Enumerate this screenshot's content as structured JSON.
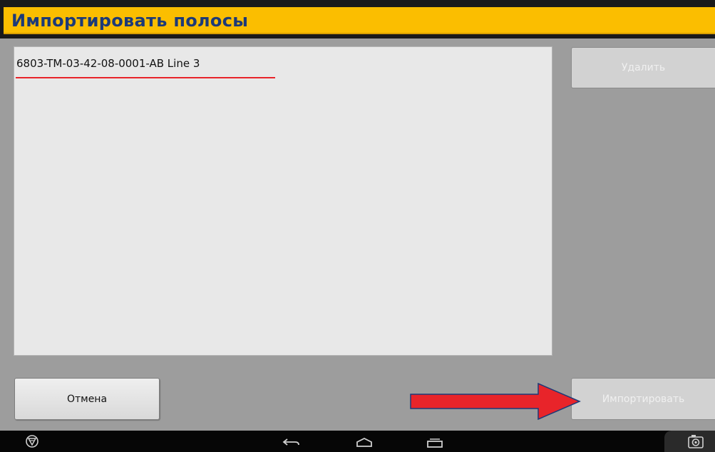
{
  "header": {
    "title": "Импортировать полосы"
  },
  "list": {
    "items": [
      {
        "label": "6803-TM-03-42-08-0001-AB Line 3"
      }
    ]
  },
  "buttons": {
    "delete_label": "Удалить",
    "cancel_label": "Отмена",
    "import_label": "Импортировать"
  },
  "nav": {
    "icons": [
      "app-logo-icon",
      "back-icon",
      "home-icon",
      "recent-apps-icon",
      "screenshot-icon"
    ]
  },
  "colors": {
    "header_background": "#fbbe00",
    "header_text": "#1d3a78",
    "selection_underline": "#e8242a",
    "annotation_arrow": "#e8242a",
    "annotation_arrow_outline": "#1d3a78"
  }
}
